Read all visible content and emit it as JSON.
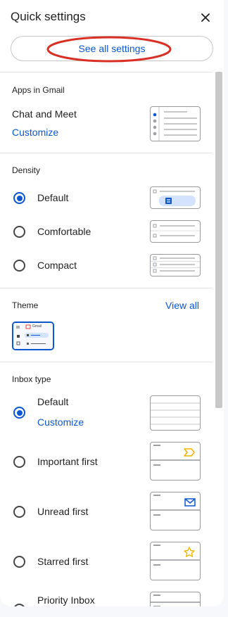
{
  "header": {
    "title": "Quick settings",
    "close_icon": "close-icon"
  },
  "see_all": {
    "label": "See all settings",
    "annotation_color": "#d93025"
  },
  "apps_in_gmail": {
    "section_label": "Apps in Gmail",
    "item_label": "Chat and Meet",
    "customize_label": "Customize"
  },
  "density": {
    "section_label": "Density",
    "options": [
      {
        "label": "Default",
        "selected": true
      },
      {
        "label": "Comfortable",
        "selected": false
      },
      {
        "label": "Compact",
        "selected": false
      }
    ]
  },
  "theme": {
    "section_label": "Theme",
    "view_all_label": "View all",
    "thumbnail_brand": "Gmail"
  },
  "inbox_type": {
    "section_label": "Inbox type",
    "customize_label": "Customize",
    "options": [
      {
        "label": "Default",
        "selected": true,
        "icon": ""
      },
      {
        "label": "Important first",
        "selected": false,
        "icon": "important-marker-icon"
      },
      {
        "label": "Unread first",
        "selected": false,
        "icon": "envelope-icon"
      },
      {
        "label": "Starred first",
        "selected": false,
        "icon": "star-icon"
      },
      {
        "label": "Priority Inbox",
        "selected": false,
        "icon": ""
      }
    ]
  },
  "colors": {
    "accent": "#0b57d0",
    "selected_fill": "#d3e3fd",
    "important": "#f4b400",
    "star": "#f4b400"
  }
}
